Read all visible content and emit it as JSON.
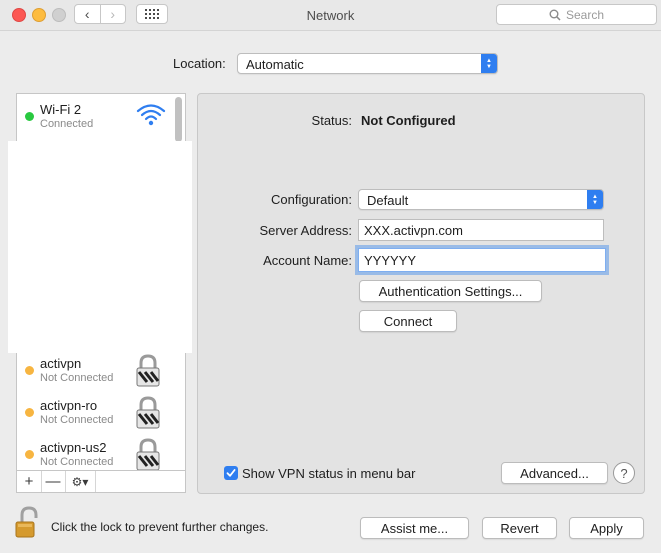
{
  "window": {
    "title": "Network",
    "search_placeholder": "Search",
    "nav_back_glyph": "‹",
    "nav_forward_glyph": "›"
  },
  "location": {
    "label": "Location:",
    "value": "Automatic"
  },
  "sidebar": {
    "services": [
      {
        "name": "Wi-Fi 2",
        "status": "Connected",
        "dot_color": "#29c940",
        "icon": "wifi-icon"
      },
      {
        "name": "activpn",
        "status": "Not Connected",
        "dot_color": "#f7b541",
        "icon": "vpn-lock-icon"
      },
      {
        "name": "activpn-ro",
        "status": "Not Connected",
        "dot_color": "#f7b541",
        "icon": "vpn-lock-icon"
      },
      {
        "name": "activpn-us2",
        "status": "Not Connected",
        "dot_color": "#f7b541",
        "icon": "vpn-lock-icon"
      }
    ],
    "toolbar": {
      "add": "+",
      "remove": "—",
      "action": "⚙▾"
    }
  },
  "detail": {
    "status_label": "Status:",
    "status_value": "Not Configured",
    "configuration_label": "Configuration:",
    "configuration_value": "Default",
    "server_address_label": "Server Address:",
    "server_address_value": "XXX.activpn.com",
    "account_name_label": "Account Name:",
    "account_name_value": "YYYYYY",
    "auth_settings_button": "Authentication Settings...",
    "connect_button": "Connect",
    "show_vpn_status_label": "Show VPN status in menu bar",
    "show_vpn_status_checked": true,
    "advanced_button": "Advanced...",
    "help_button": "?"
  },
  "footer": {
    "lock_text": "Click the lock to prevent further changes.",
    "assist_button": "Assist me...",
    "revert_button": "Revert",
    "apply_button": "Apply"
  },
  "colors": {
    "accent": "#2f7ef0",
    "connected": "#29c940",
    "not_connected": "#f7b541"
  }
}
